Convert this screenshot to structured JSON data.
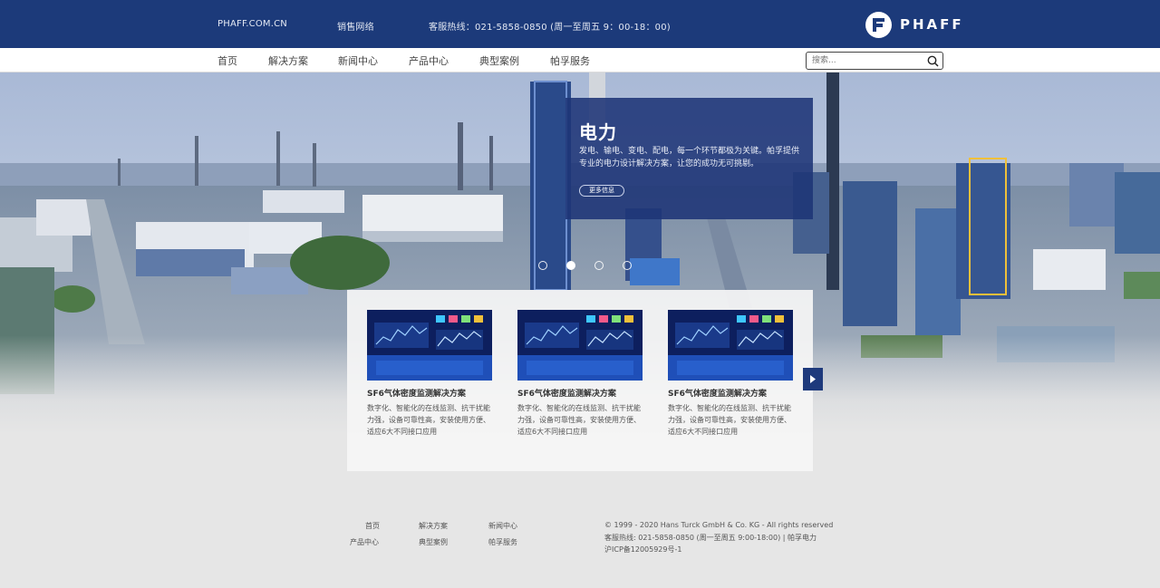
{
  "topbar": {
    "site": "PHAFF.COM.CN",
    "sales": "销售网络",
    "hotline": "客服热线：021-5858-0850 (周一至周五 9：00-18：00)",
    "logo_text": "PHAFF"
  },
  "nav": {
    "items": [
      "首页",
      "解决方案",
      "新闻中心",
      "产品中心",
      "典型案例",
      "帕孚服务"
    ],
    "search_placeholder": "搜索..."
  },
  "banner": {
    "title": "电力",
    "description": "发电、输电、变电、配电，每一个环节都极为关键。帕孚提供专业的电力设计解决方案，让您的成功无可挑剔。",
    "button": "更多信息"
  },
  "slider": {
    "count": 4,
    "active": 1
  },
  "cards": [
    {
      "title": "SF6气体密度监测解决方案",
      "description": "数字化、智能化的在线监测、抗干扰能力强，设备可靠性高，安装使用方便、适应6大不同接口应用"
    },
    {
      "title": "SF6气体密度监测解决方案",
      "description": "数字化、智能化的在线监测、抗干扰能力强，设备可靠性高，安装使用方便、适应6大不同接口应用"
    },
    {
      "title": "SF6气体密度监测解决方案",
      "description": "数字化、智能化的在线监测、抗干扰能力强，设备可靠性高，安装使用方便、适应6大不同接口应用"
    }
  ],
  "footer": {
    "links": [
      "首页",
      "解决方案",
      "新闻中心",
      "产品中心",
      "典型案例",
      "帕孚服务"
    ],
    "copyright": "© 1999 - 2020 Hans Turck GmbH & Co. KG - All rights reserved",
    "hotline": "客服热线: 021-5858-0850 (周一至周五 9:00-18:00) | 帕孚电力",
    "icp": "沪ICP备12005929号-1"
  },
  "colors": {
    "brand": "#1c3a7a",
    "banner_overlay": "#1e3476",
    "background": "#e6e6e6"
  },
  "icons": {
    "logo": "phaff-logo-icon",
    "search": "search-icon",
    "next": "chevron-right-icon"
  }
}
